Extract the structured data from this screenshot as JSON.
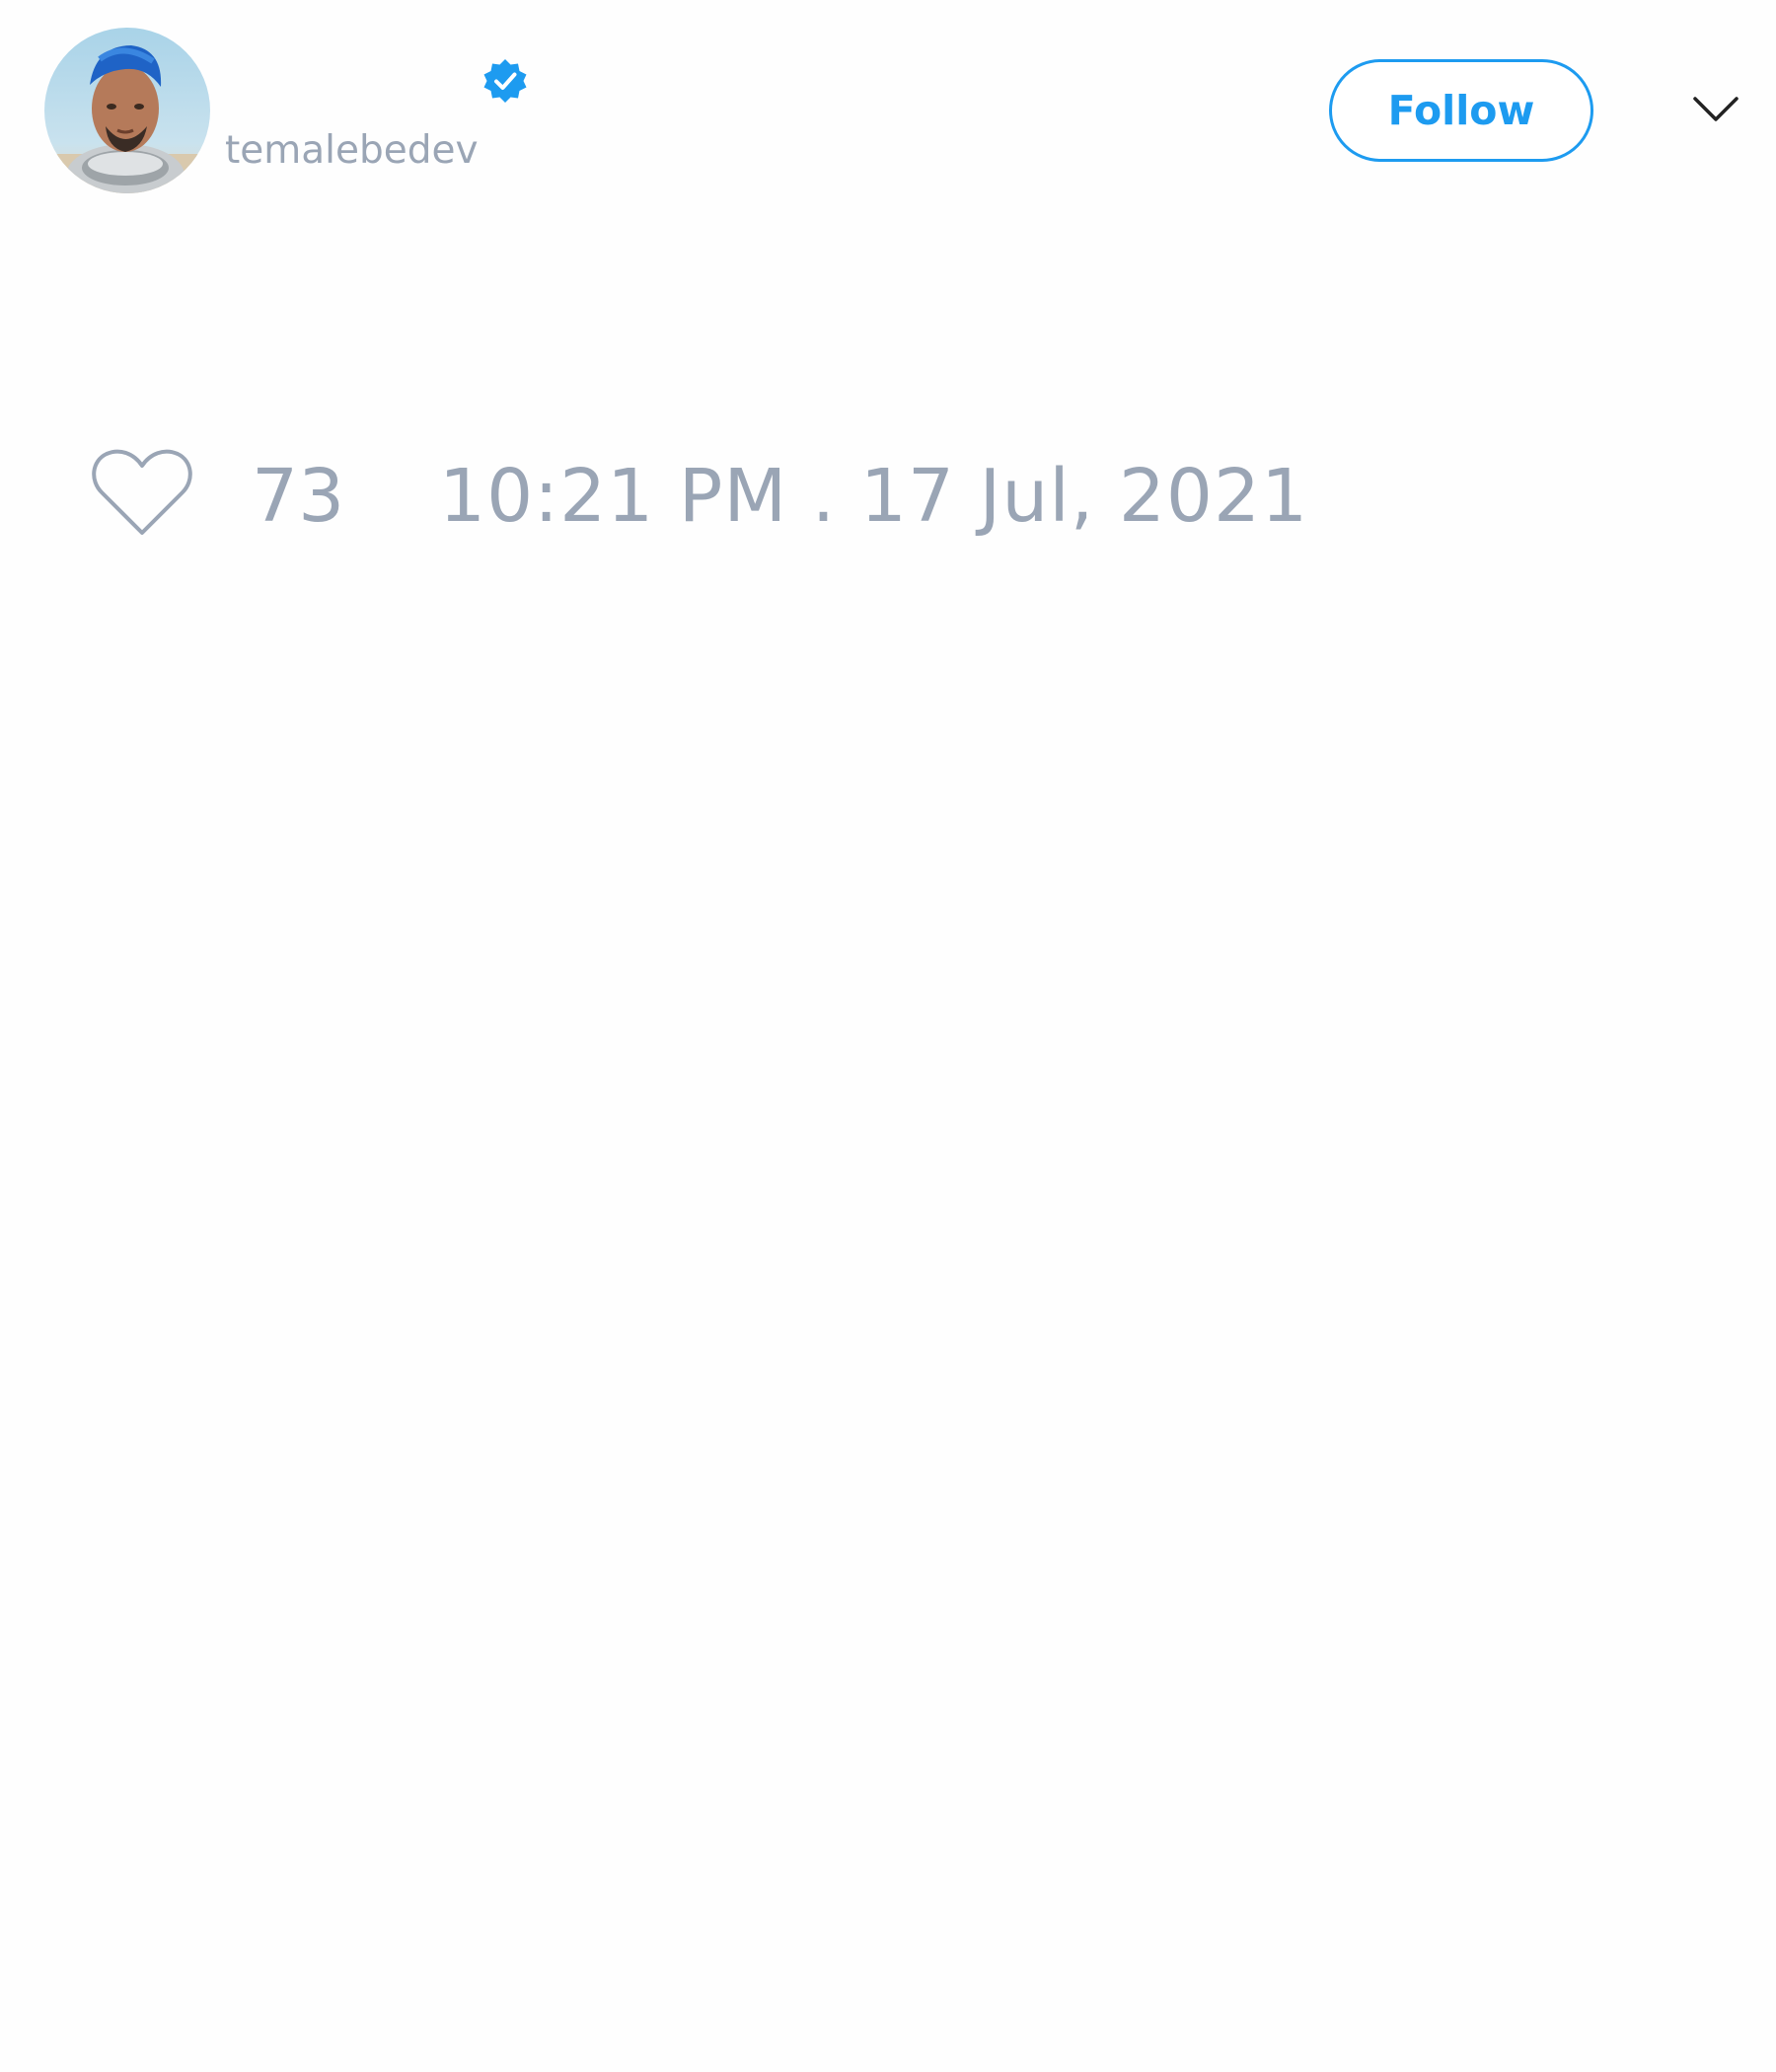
{
  "author": {
    "handle": "temalebedev",
    "verified": true
  },
  "header": {
    "follow_label": "Follow",
    "menu_icon": "chevron-down-icon"
  },
  "tweet": {
    "like_icon": "heart-outline-icon",
    "like_count": "73",
    "timestamp": "10:21 PM . 17 Jul, 2021"
  },
  "colors": {
    "accent": "#1d9bf0",
    "muted_text": "#9aa5b5",
    "background": "#fefefe"
  }
}
